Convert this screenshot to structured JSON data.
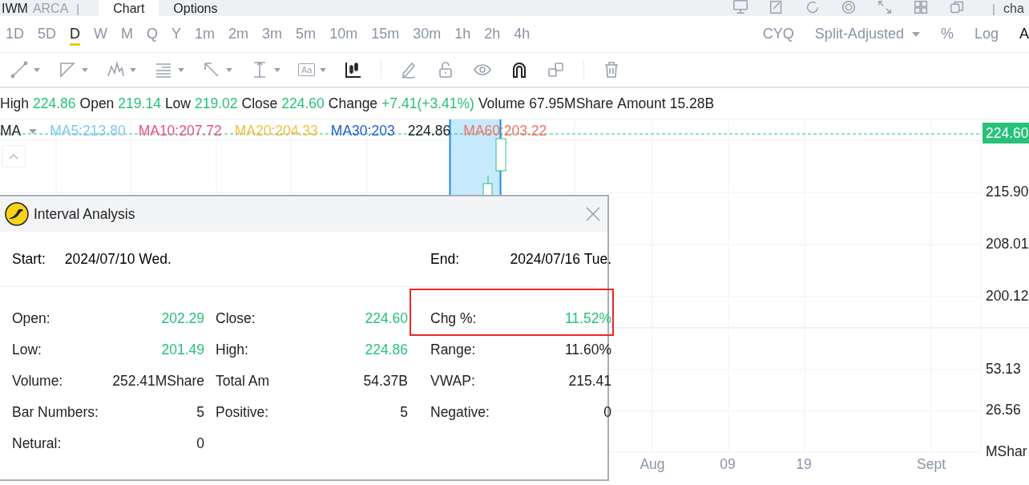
{
  "header": {
    "symbol": "IWM",
    "exchange": "ARCA",
    "separator": "|",
    "tabs": [
      {
        "label": "Chart",
        "selected": true
      },
      {
        "label": "Options",
        "selected": false
      }
    ],
    "right_separator": "|",
    "right_text": "cha"
  },
  "periods": [
    {
      "label": "1D",
      "selected": false
    },
    {
      "label": "5D",
      "selected": false
    },
    {
      "label": "D",
      "selected": true
    },
    {
      "label": "W",
      "selected": false
    },
    {
      "label": "M",
      "selected": false
    },
    {
      "label": "Q",
      "selected": false
    },
    {
      "label": "Y",
      "selected": false
    },
    {
      "label": "1m",
      "selected": false
    },
    {
      "label": "2m",
      "selected": false
    },
    {
      "label": "3m",
      "selected": false
    },
    {
      "label": "5m",
      "selected": false
    },
    {
      "label": "10m",
      "selected": false
    },
    {
      "label": "15m",
      "selected": false
    },
    {
      "label": "30m",
      "selected": false
    },
    {
      "label": "1h",
      "selected": false
    },
    {
      "label": "2h",
      "selected": false
    },
    {
      "label": "4h",
      "selected": false
    }
  ],
  "options": [
    {
      "label": "CYQ",
      "kind": "toggle",
      "selected": false
    },
    {
      "label": "Split-Adjusted",
      "kind": "dropdown",
      "selected": false
    },
    {
      "label": "%",
      "kind": "toggle",
      "selected": false
    },
    {
      "label": "Log",
      "kind": "toggle",
      "selected": false
    },
    {
      "label": "A",
      "kind": "toggle",
      "selected": true
    }
  ],
  "tools": [
    {
      "kind": "line",
      "dropdown": true,
      "active": false
    },
    {
      "kind": "polyline",
      "dropdown": true,
      "active": false
    },
    {
      "kind": "pattern",
      "dropdown": true,
      "active": false
    },
    {
      "kind": "fib",
      "dropdown": true,
      "active": false
    },
    {
      "kind": "arrow",
      "dropdown": true,
      "active": false
    },
    {
      "kind": "measure",
      "dropdown": true,
      "active": false
    },
    {
      "kind": "textbox",
      "text": "Aa",
      "dropdown": true,
      "active": false
    },
    {
      "kind": "candles",
      "dropdown": false,
      "active": true
    },
    {
      "kind": "divider"
    },
    {
      "kind": "pencil",
      "dropdown": false,
      "active": false
    },
    {
      "kind": "lock",
      "dropdown": false,
      "active": false
    },
    {
      "kind": "eye",
      "dropdown": false,
      "active": false
    },
    {
      "kind": "magnet",
      "dropdown": false,
      "active": true
    },
    {
      "kind": "copy",
      "dropdown": false,
      "active": false
    },
    {
      "kind": "divider"
    },
    {
      "kind": "trash",
      "dropdown": false,
      "active": false
    }
  ],
  "quote": [
    {
      "label": "High",
      "value": "224.86",
      "up": true
    },
    {
      "label": "Open",
      "value": "219.14",
      "up": true
    },
    {
      "label": "Low",
      "value": "219.02",
      "up": true
    },
    {
      "label": "Close",
      "value": "224.60",
      "up": true
    },
    {
      "label": "Change",
      "value": "+7.41(+3.41%)",
      "up": true
    },
    {
      "label": "Volume",
      "value": "67.95MShare",
      "up": false
    },
    {
      "label": "Amount",
      "value": "15.28B",
      "up": false
    }
  ],
  "ma_legend": {
    "label": "MA",
    "items": [
      {
        "text": "MA5:213.80",
        "color": "#7ec8f0"
      },
      {
        "text": "MA10:207.72",
        "color": "#e8508a"
      },
      {
        "text": "MA20:204.33",
        "color": "#f0c040"
      },
      {
        "text": "MA30:203",
        "color": "#1f5fd0"
      },
      {
        "text": "MA60:203.22",
        "color": "#f07060"
      }
    ],
    "crosshair_value": "224.86"
  },
  "price_axis": {
    "last_price": "224.60",
    "labels": [
      "215.90",
      "208.01",
      "200.12"
    ]
  },
  "volume_axis": {
    "labels": [
      "53.13",
      "26.56"
    ],
    "unit": "MShar"
  },
  "time_axis": [
    "Aug",
    "09",
    "19",
    "Sept"
  ],
  "dialog": {
    "title": "Interval Analysis",
    "start_label": "Start:",
    "start": "2024/07/10 Wed.",
    "end_label": "End:",
    "end": "2024/07/16 Tue.",
    "rows": [
      [
        {
          "label": "Open:",
          "value": "202.29",
          "up": true,
          "highlighted": false
        },
        {
          "label": "Close:",
          "value": "224.60",
          "up": true,
          "highlighted": false
        },
        {
          "label": "Chg %:",
          "value": "11.52%",
          "up": true,
          "highlighted": true
        }
      ],
      [
        {
          "label": "Low:",
          "value": "201.49",
          "up": true,
          "highlighted": false
        },
        {
          "label": "High:",
          "value": "224.86",
          "up": true,
          "highlighted": false
        },
        {
          "label": "Range:",
          "value": "11.60%",
          "up": false,
          "highlighted": false
        }
      ],
      [
        {
          "label": "Volume:",
          "value": "252.41MShare",
          "up": false,
          "highlighted": false
        },
        {
          "label": "Total Am",
          "value": "54.37B",
          "up": false,
          "highlighted": false
        },
        {
          "label": "VWAP:",
          "value": "215.41",
          "up": false,
          "highlighted": false
        }
      ],
      [
        {
          "label": "Bar Numbers:",
          "value": "5",
          "up": false,
          "highlighted": false
        },
        {
          "label": "Positive:",
          "value": "5",
          "up": false,
          "highlighted": false
        },
        {
          "label": "Negative:",
          "value": "0",
          "up": false,
          "highlighted": false
        }
      ],
      [
        {
          "label": "Netural:",
          "value": "0",
          "up": false,
          "highlighted": false
        }
      ]
    ]
  }
}
